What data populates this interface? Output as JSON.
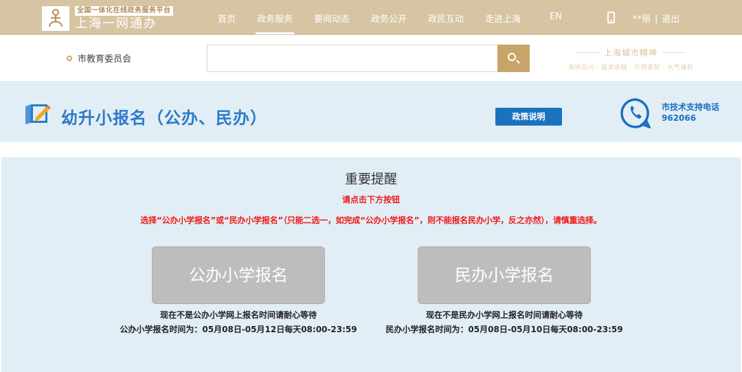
{
  "header": {
    "logo_tag": "全国一体化在线政务服务平台",
    "logo_title": "上海一网通办",
    "nav": [
      "首页",
      "政务服务",
      "要闻动态",
      "政务公开",
      "政民互动",
      "走进上海",
      "EN"
    ],
    "active_nav": "政务服务",
    "user_name": "**丽",
    "separator": "|",
    "logout": "退出",
    "accent_color": "#d6c4a2"
  },
  "search": {
    "location": "市教育委员会",
    "placeholder": "",
    "button_icon": "search-icon"
  },
  "spirit": {
    "title": "上海城市精神",
    "subtitle": "海纳百川 · 追求卓越 · 开明睿智 · 大气谦和"
  },
  "service": {
    "title": "幼升小报名（公办、民办）",
    "policy_button": "政策说明",
    "support_label": "市技术支持电话",
    "support_phone": "962066",
    "brand_color": "#1a72bf"
  },
  "notice": {
    "title": "重要提醒",
    "sub": "请点击下方按钮",
    "rule": "选择“公办小学报名”或“民办小学报名”（只能二选一，如完成“公办小学报名”，则不能报名民办小学，反之亦然），请慎重选择。",
    "alert_color": "#ee1c1c"
  },
  "options": {
    "public": {
      "button": "公办小学报名",
      "status": "现在不是公办小学网上报名时间请耐心等待",
      "period": "公办小学报名时间为：05月08日-05月12日每天08:00-23:59"
    },
    "private": {
      "button": "民办小学报名",
      "status": "现在不是民办小学网上报名时间请耐心等待",
      "period": "民办小学报名时间为：05月08日-05月10日每天08:00-23:59"
    }
  }
}
